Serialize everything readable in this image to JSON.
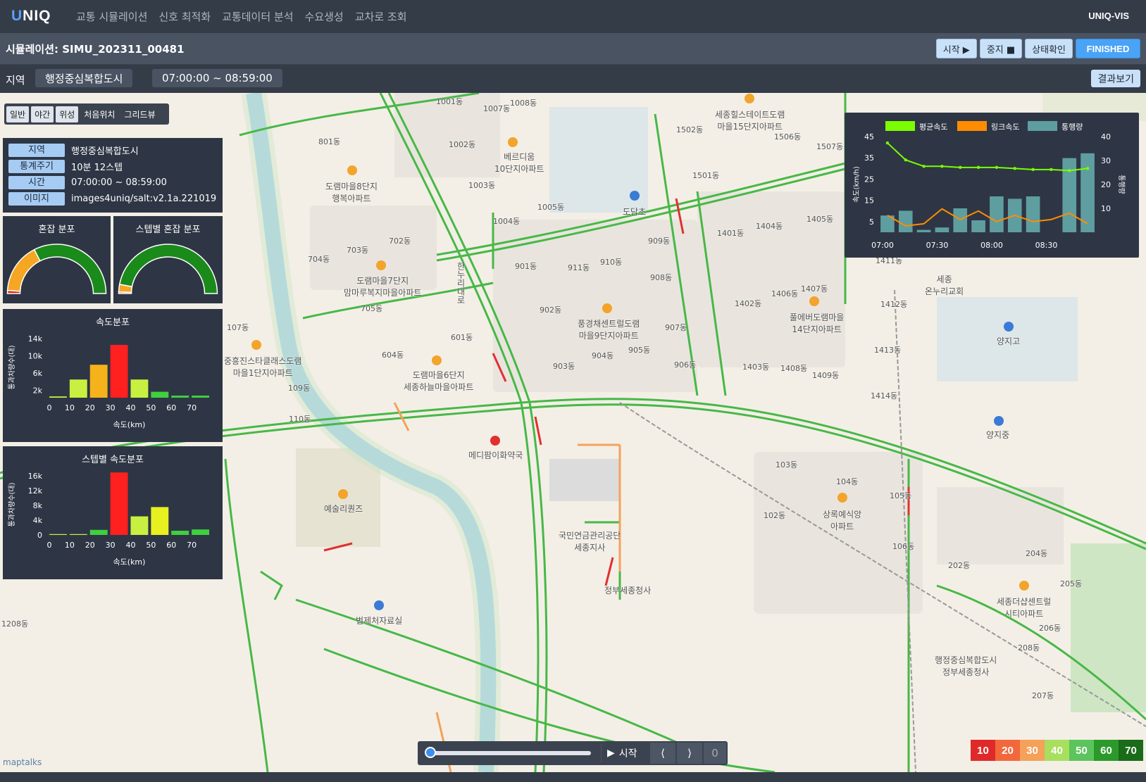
{
  "app": {
    "logo_u": "U",
    "logo_rest": "NIQ",
    "brand": "UNIQ-VIS"
  },
  "nav": [
    "교통 시뮬레이션",
    "신호 최적화",
    "교통데이터 분석",
    "수요생성",
    "교차로 조회"
  ],
  "sim": {
    "title": "시뮬레이션: SIMU_202311_00481",
    "buttons": {
      "start": "시작 ▶",
      "stop": "중지 ■",
      "status": "상태확인",
      "finished": "FINISHED"
    }
  },
  "region_bar": {
    "label": "지역",
    "region": "행정중심복합도시",
    "time": "07:00:00 ~ 08:59:00",
    "result": "결과보기"
  },
  "basemaps": [
    "일반",
    "야간",
    "위성",
    "처음위치",
    "그리드뷰"
  ],
  "info": [
    {
      "key": "지역",
      "value": "행정중심복합도시"
    },
    {
      "key": "통계주기",
      "value": "10분   12스텝"
    },
    {
      "key": "시간",
      "value": "07:00:00 ~ 08:59:00"
    },
    {
      "key": "이미지",
      "value": "images4uniq/salt:v2.1a.221019"
    }
  ],
  "gauges": [
    {
      "title": "혼잡 분포",
      "fractions": [
        0.02,
        0.33,
        0.65
      ],
      "colors": [
        "#e02020",
        "#f5a623",
        "#1a8a1a"
      ]
    },
    {
      "title": "스텝별 혼잡 분포",
      "fractions": [
        0.01,
        0.05,
        0.94
      ],
      "colors": [
        "#e02020",
        "#f5a623",
        "#1a8a1a"
      ]
    }
  ],
  "speed_hist": {
    "title": "속도분포",
    "xlabel": "속도(km)",
    "ylabel": "통과차량수(대)",
    "yticks": [
      "14k",
      "10k",
      "6k",
      "2k"
    ],
    "xticks": [
      "0",
      "10",
      "20",
      "30",
      "40",
      "50",
      "60",
      "70"
    ],
    "values": [
      300,
      4300,
      7800,
      12500,
      4300,
      1400,
      500,
      500
    ],
    "colors": [
      "#c8f040",
      "#c8f040",
      "#f5b21a",
      "#ff2020",
      "#c8f040",
      "#3fcf3f",
      "#3fcf3f",
      "#3fcf3f"
    ],
    "ymax": 16000
  },
  "step_hist": {
    "title": "스텝별 속도분포",
    "xlabel": "속도(km)",
    "ylabel": "통과차량수(대)",
    "yticks": [
      "16k",
      "12k",
      "8k",
      "4k",
      "0"
    ],
    "xticks": [
      "0",
      "10",
      "20",
      "30",
      "40",
      "50",
      "60",
      "70"
    ],
    "values": [
      200,
      200,
      1200,
      14800,
      4400,
      6600,
      1000,
      1300
    ],
    "colors": [
      "#c8f040",
      "#c8f040",
      "#3fcf3f",
      "#ff2020",
      "#c8f040",
      "#e8f020",
      "#3fcf3f",
      "#3fcf3f"
    ],
    "ymax": 16000
  },
  "chart_data": {
    "type": "bar",
    "legend": [
      "평균속도",
      "링크속도",
      "통행량"
    ],
    "legend_colors": [
      "#7cfc00",
      "#ff8c00",
      "#5f9ea0"
    ],
    "x": [
      "07:00",
      "07:10",
      "07:20",
      "07:30",
      "07:40",
      "07:50",
      "08:00",
      "08:10",
      "08:20",
      "08:30",
      "08:40",
      "08:50"
    ],
    "xticks": [
      "07:00",
      "07:30",
      "08:00",
      "08:30"
    ],
    "ylabel": "속도(km/h)",
    "y2label": "통행량",
    "yticks": [
      "45",
      "35",
      "25",
      "15",
      "5"
    ],
    "y2ticks": [
      "40",
      "30",
      "20",
      "10"
    ],
    "series": [
      {
        "name": "통행량",
        "axis": "y2",
        "values": [
          7,
          9,
          1,
          2,
          10,
          5,
          15,
          14,
          15,
          0,
          31,
          33
        ]
      },
      {
        "name": "평균속도",
        "axis": "y",
        "values": [
          42,
          34,
          31,
          31,
          30.5,
          30.5,
          30.5,
          30,
          29.5,
          29.5,
          29,
          30
        ]
      },
      {
        "name": "링크속도",
        "axis": "y",
        "values": [
          8,
          3,
          4,
          11,
          6,
          10,
          5,
          8,
          5,
          6,
          9,
          4
        ]
      }
    ],
    "ylim": [
      0,
      45
    ],
    "y2lim": [
      0,
      40
    ]
  },
  "map_labels": [
    "1001동",
    "1007동",
    "1008동",
    "801동",
    "1002동",
    "1003동",
    "1004동",
    "1005동",
    "702동",
    "703동",
    "704동",
    "705동",
    "601동",
    "604동",
    "901동",
    "902동",
    "903동",
    "904동",
    "905동",
    "906동",
    "907동",
    "908동",
    "909동",
    "910동",
    "911동",
    "1401동",
    "1402동",
    "1403동",
    "1404동",
    "1405동",
    "1406동",
    "1407동",
    "1408동",
    "1409동",
    "1411동",
    "1412동",
    "1413동",
    "1414동",
    "1501동",
    "1502동",
    "1506동",
    "1507동",
    "103동",
    "104동",
    "105동",
    "102동",
    "106동",
    "202동",
    "204동",
    "205동",
    "206동",
    "207동",
    "208동",
    "109동",
    "110동",
    "107동",
    "1208동",
    "도램마을8단지\n행복아파트",
    "도램마을7단지\n맘마루복지마을아파트",
    "도램마을6단지\n세종하늘마을아파트",
    "풍경채센트럴도램\n마을9단지아파트",
    "세종힐스테이트도램\n마을15단지아파트",
    "도담초",
    "양지고",
    "양지중",
    "메디팜이화약국",
    "예술리퀀즈",
    "국민연금관리공단\n세종지사",
    "정부세종청사",
    "법제처자료실",
    "행정중심복합도시\n정부세종청사",
    "상록예식앙\n아파트",
    "세종더샵센트럴\n시티아파트",
    "세종\n온누리교회",
    "풀에버도램마을\n14단지아파트",
    "중흥진스타클래스도램\n마을1단지아파트",
    "베르디움\n10단지아파트",
    "한누리대로"
  ],
  "speed_legend": {
    "labels": [
      "10",
      "20",
      "30",
      "40",
      "50",
      "60",
      "70"
    ],
    "colors": [
      "#e02a2a",
      "#f2683c",
      "#f5a15a",
      "#a8df5e",
      "#5cc45c",
      "#2b9a2b",
      "#1a6b1a"
    ]
  },
  "player": {
    "play_label": "시작",
    "prev": "⟨",
    "next": "⟩",
    "step": "0",
    "progress": 0.0
  },
  "attribution": "maptalks"
}
